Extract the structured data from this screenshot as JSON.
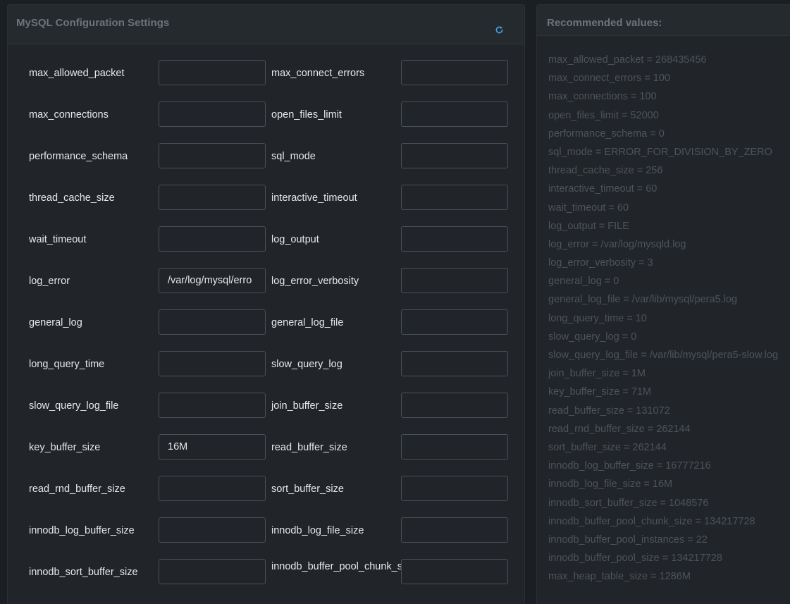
{
  "config_panel": {
    "title": "MySQL Configuration Settings",
    "refresh_icon": "refresh-icon",
    "rows": [
      {
        "left": {
          "label": "max_allowed_packet",
          "value": ""
        },
        "right": {
          "label": "max_connect_errors",
          "value": ""
        }
      },
      {
        "left": {
          "label": "max_connections",
          "value": ""
        },
        "right": {
          "label": "open_files_limit",
          "value": ""
        }
      },
      {
        "left": {
          "label": "performance_schema",
          "value": ""
        },
        "right": {
          "label": "sql_mode",
          "value": ""
        }
      },
      {
        "left": {
          "label": "thread_cache_size",
          "value": ""
        },
        "right": {
          "label": "interactive_timeout",
          "value": ""
        }
      },
      {
        "left": {
          "label": "wait_timeout",
          "value": ""
        },
        "right": {
          "label": "log_output",
          "value": ""
        }
      },
      {
        "left": {
          "label": "log_error",
          "value": "/var/log/mysql/erro"
        },
        "right": {
          "label": "log_error_verbosity",
          "value": ""
        }
      },
      {
        "left": {
          "label": "general_log",
          "value": ""
        },
        "right": {
          "label": "general_log_file",
          "value": ""
        }
      },
      {
        "left": {
          "label": "long_query_time",
          "value": ""
        },
        "right": {
          "label": "slow_query_log",
          "value": ""
        }
      },
      {
        "left": {
          "label": "slow_query_log_file",
          "value": ""
        },
        "right": {
          "label": "join_buffer_size",
          "value": ""
        }
      },
      {
        "left": {
          "label": "key_buffer_size",
          "value": "16M"
        },
        "right": {
          "label": "read_buffer_size",
          "value": ""
        }
      },
      {
        "left": {
          "label": "read_rnd_buffer_size",
          "value": ""
        },
        "right": {
          "label": "sort_buffer_size",
          "value": ""
        }
      },
      {
        "left": {
          "label": "innodb_log_buffer_size",
          "value": ""
        },
        "right": {
          "label": "innodb_log_file_size",
          "value": ""
        }
      },
      {
        "left": {
          "label": "innodb_sort_buffer_size",
          "value": ""
        },
        "right": {
          "label": "innodb_buffer_pool_chunk_size",
          "value": ""
        }
      }
    ]
  },
  "recommended_panel": {
    "title": "Recommended values:",
    "items": [
      "max_allowed_packet = 268435456",
      "max_connect_errors = 100",
      "max_connections = 100",
      "open_files_limit = 52000",
      "performance_schema = 0",
      "sql_mode = ERROR_FOR_DIVISION_BY_ZERO",
      "thread_cache_size = 256",
      "interactive_timeout = 60",
      "wait_timeout = 60",
      "log_output = FILE",
      "log_error = /var/log/mysqld.log",
      "log_error_verbosity = 3",
      "general_log = 0",
      "general_log_file = /var/lib/mysql/pera5.log",
      "long_query_time = 10",
      "slow_query_log = 0",
      "slow_query_log_file = /var/lib/mysql/pera5-slow.log",
      "join_buffer_size = 1M",
      "key_buffer_size = 71M",
      "read_buffer_size = 131072",
      "read_rnd_buffer_size = 262144",
      "sort_buffer_size = 262144",
      "innodb_log_buffer_size = 16777216",
      "innodb_log_file_size = 16M",
      "innodb_sort_buffer_size = 1048576",
      "innodb_buffer_pool_chunk_size = 134217728",
      "innodb_buffer_pool_instances = 22",
      "innodb_buffer_pool_size = 134217728",
      "max_heap_table_size = 1286M"
    ]
  },
  "colors": {
    "background": "#1b1e22",
    "panel": "#212529",
    "panel_header": "#252a2f",
    "label_text": "#e6e8ea",
    "muted_text": "#4c535a",
    "accent": "#4aa3df"
  }
}
